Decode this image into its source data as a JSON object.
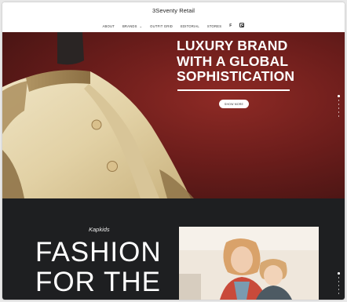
{
  "header": {
    "brand": "3Seventy Retail",
    "nav": [
      {
        "label": "About"
      },
      {
        "label": "Brands"
      },
      {
        "label": "Outfit Grid"
      },
      {
        "label": "Editorial"
      },
      {
        "label": "Stores"
      }
    ],
    "social": {
      "facebook_glyph": "f",
      "facebook_icon": "facebook-icon",
      "instagram_icon": "instagram-icon"
    }
  },
  "hero": {
    "title": "LUXURY BRAND\nWITH A GLOBAL\nSOPHISTICATION",
    "button": "Show More",
    "image": "embroidered-sherwani-jacket-on-mannequin",
    "slide_count": 6,
    "active_slide": 1
  },
  "feature": {
    "eyebrow": "Kapkids",
    "title": "FASHION\nFOR THE",
    "image": "two-children-portrait",
    "slide_count": 6,
    "active_slide": 1
  },
  "colors": {
    "hero_bg": "#6b1d1b",
    "dark_bg": "#1e1f21",
    "text_light": "#ffffff"
  }
}
